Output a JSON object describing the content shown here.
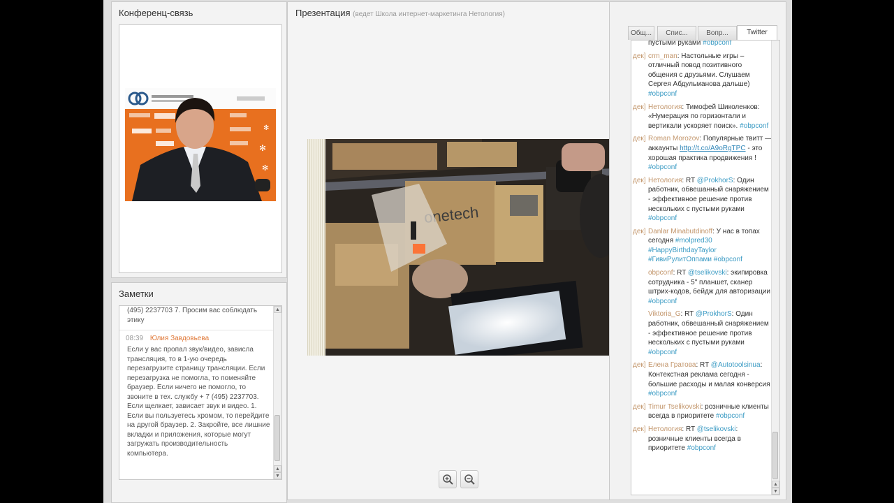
{
  "conference": {
    "title": "Конференц-связь"
  },
  "notes": {
    "title": "Заметки",
    "first_text": "(495) 2237703 7. Просим вас соблюдать этику",
    "entry_time": "08:39",
    "entry_author": "Юлия Завдовьева",
    "entry_text": "Если у вас пропал звук/видео, зависла трансляция, то в 1-ую очередь перезагрузите страницу трансляции. Если перезагрузка не помогла, то поменяйте браузер. Если ничего не помогло, то звоните в тех. службу + 7 (495) 2237703.\nЕсли щелкает, зависает звук и видео. 1. Если вы пользуетесь хромом, то перейдите на другой браузер. 2. Закройте, все лишние вкладки и приложения, которые могут загружать производительность компьютера."
  },
  "presentation": {
    "title": "Презентация",
    "subtitle": "(ведет Школа интернет-маркетинга Нетология)"
  },
  "twitter": {
    "tabs": [
      "Общ...",
      "Спис...",
      "Вопр...",
      "Twitter"
    ],
    "active_tab": "Twitter",
    "tweets": [
      {
        "prefix": "",
        "author": "",
        "text": "пустыми руками ",
        "hashtag": "#obpconf"
      },
      {
        "prefix": "дек]",
        "author": "crm_man",
        "text": "Настольные игры – отличный повод позитивного общения с друзьями. Слушаем Сергея Абдульманова дальше) ",
        "hashtag": "#obpconf"
      },
      {
        "prefix": "дек]",
        "author": "Нетология",
        "text": "Тимофей Шиколенков: «Нумерация по горизонтали и вертикали ускоряет поиск». ",
        "hashtag": "#obpconf"
      },
      {
        "prefix": "дек]",
        "author": "Roman Morozov",
        "text": "Популярные твитт — аккаунты ",
        "link": "http://t.co/A9oRgTPC",
        "text2": " - это хорошая практика продвижения ! ",
        "hashtag": "#obpconf"
      },
      {
        "prefix": "дек]",
        "author": "Нетология",
        "text": "RT ",
        "mention": "@ProkhorS",
        "text2": ": Один работник, обвешанный снаряжением - эффективное решение против нескольких с пустыми руками ",
        "hashtag": "#obpconf"
      },
      {
        "prefix": "дек]",
        "author": "Danlar Minabutdinoff",
        "text": "У нас в топах сегодня ",
        "hashtag": "#molpred30 #HappyBirthdayTaylor #ГивиРулитОппами #obpconf"
      },
      {
        "prefix": "",
        "author": "obpconf",
        "text": "RT ",
        "mention": "@tselikovski",
        "text2": ": экипировка сотрудника - 5\" планшет, сканер штрих-кодов, бейдж для авторизации ",
        "hashtag": "#obpconf"
      },
      {
        "prefix": "",
        "author": "Viktoria_G",
        "text": "RT ",
        "mention": "@ProkhorS",
        "text2": ": Один работник, обвешанный снаряжением - эффективное решение против нескольких с пустыми руками ",
        "hashtag": "#obpconf"
      },
      {
        "prefix": "дек]",
        "author": "Елена Гратова",
        "text": "RT ",
        "mention": "@Autotoolsinua",
        "text2": ": Контекстная реклама сегодня - большие расходы и малая конверсия ",
        "hashtag": "#obpconf"
      },
      {
        "prefix": "дек]",
        "author": "Timur Tselikovski",
        "text": "розничные клиенты всегда в приоритете ",
        "hashtag": "#obpconf"
      },
      {
        "prefix": "дек]",
        "author": "Нетология",
        "text": "RT ",
        "mention": "@tselikovski",
        "text2": ": розничные клиенты всегда в приоритете ",
        "hashtag": "#obpconf"
      }
    ]
  },
  "colors": {
    "accent_orange": "#e8701f",
    "hashtag": "#3b9bc4",
    "author": "#c2956a"
  },
  "icons": {
    "zoom_in": "zoom-in-icon",
    "zoom_out": "zoom-out-icon"
  }
}
